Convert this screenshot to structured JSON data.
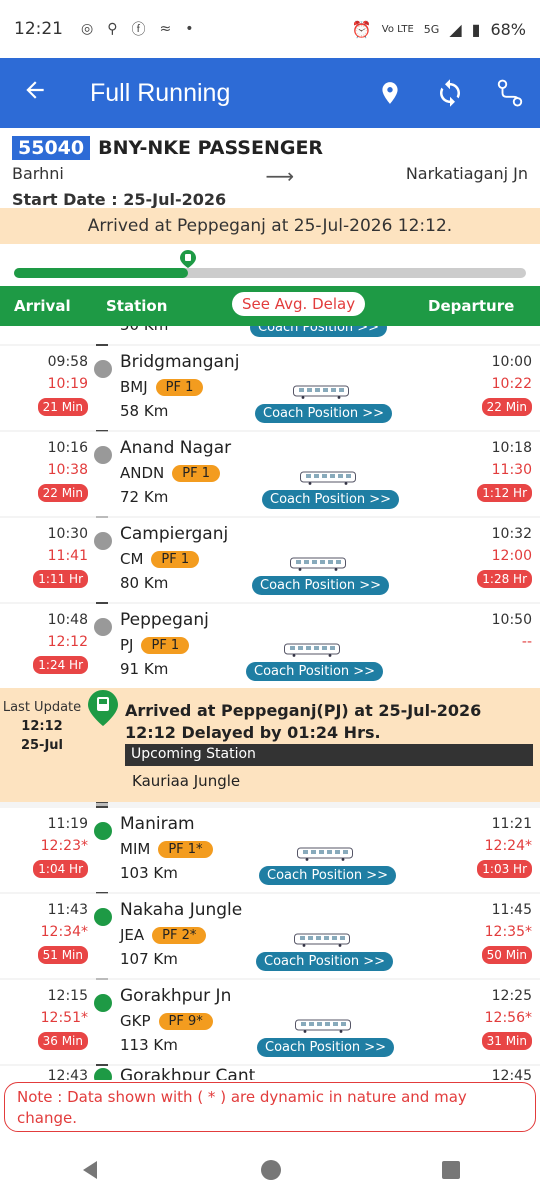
{
  "status_bar": {
    "time": "12:21",
    "battery": "68%",
    "network": "5G"
  },
  "app_bar": {
    "title": "Full Running",
    "back_icon": "arrow-left-icon",
    "icons": [
      "location-pin-icon",
      "refresh-icon",
      "route-icon"
    ]
  },
  "train": {
    "number": "55040",
    "name": "BNY-NKE PASSENGER",
    "from": "Barhni",
    "to": "Narkatiaganj Jn",
    "start_date_label": "Start Date : ",
    "start_date": "25-Jul-2026"
  },
  "arrived_banner": "Arrived at Peppeganj at 25-Jul-2026 12:12.",
  "progress": {
    "fraction": 0.34
  },
  "table_header": {
    "arrival": "Arrival",
    "station": "Station",
    "avg_delay": "See Avg. Delay",
    "departure": "Departure"
  },
  "partial_top": {
    "km": "50 Km",
    "coach": "Coach Position >>"
  },
  "stations_before": [
    {
      "sch_arr": "09:58",
      "act_arr": "10:19",
      "delay_arr": "21 Min",
      "name": "Bridgmanganj",
      "code": "BMJ",
      "pf": "PF 1",
      "km": "58 Km",
      "sch_dep": "10:00",
      "act_dep": "10:22",
      "delay_dep": "22 Min",
      "coach": "Coach Position >>"
    },
    {
      "sch_arr": "10:16",
      "act_arr": "10:38",
      "delay_arr": "22 Min",
      "name": "Anand Nagar",
      "code": "ANDN",
      "pf": "PF 1",
      "km": "72 Km",
      "sch_dep": "10:18",
      "act_dep": "11:30",
      "delay_dep": "1:12 Hr",
      "coach": "Coach Position >>"
    },
    {
      "sch_arr": "10:30",
      "act_arr": "11:41",
      "delay_arr": "1:11 Hr",
      "name": "Campierganj",
      "code": "CM",
      "pf": "PF 1",
      "km": "80 Km",
      "sch_dep": "10:32",
      "act_dep": "12:00",
      "delay_dep": "1:28 Hr",
      "coach": "Coach Position >>"
    },
    {
      "sch_arr": "10:48",
      "act_arr": "12:12",
      "delay_arr": "1:24 Hr",
      "name": "Peppeganj",
      "code": "PJ",
      "pf": "PF 1",
      "km": "91 Km",
      "sch_dep": "10:50",
      "act_dep": "--",
      "delay_dep": "",
      "coach": "Coach Position >>"
    }
  ],
  "current": {
    "last_update": "Last Update",
    "time": "12:12",
    "date": "25-Jul",
    "message": "Arrived at Peppeganj(PJ) at 25-Jul-2026 12:12 Delayed by 01:24 Hrs.",
    "upcoming_label": "Upcoming Station",
    "upcoming_station": "Kauriaa Jungle"
  },
  "stations_after": [
    {
      "sch_arr": "11:19",
      "act_arr": "12:23*",
      "delay_arr": "1:04 Hr",
      "name": "Maniram",
      "code": "MIM",
      "pf": "PF 1*",
      "km": "103 Km",
      "sch_dep": "11:21",
      "act_dep": "12:24*",
      "delay_dep": "1:03 Hr",
      "coach": "Coach Position >>"
    },
    {
      "sch_arr": "11:43",
      "act_arr": "12:34*",
      "delay_arr": "51 Min",
      "name": "Nakaha Jungle",
      "code": "JEA",
      "pf": "PF 2*",
      "km": "107 Km",
      "sch_dep": "11:45",
      "act_dep": "12:35*",
      "delay_dep": "50 Min",
      "coach": "Coach Position >>"
    },
    {
      "sch_arr": "12:15",
      "act_arr": "12:51*",
      "delay_arr": "36 Min",
      "name": "Gorakhpur Jn",
      "code": "GKP",
      "pf": "PF 9*",
      "km": "113 Km",
      "sch_dep": "12:25",
      "act_dep": "12:56*",
      "delay_dep": "31 Min",
      "coach": "Coach Position >>"
    }
  ],
  "partial_bottom": {
    "sch_arr": "12:43",
    "name": "Gorakhpur Cant",
    "sch_dep": "12:45"
  },
  "note": "Note : Data shown with ( * ) are dynamic in nature and may change.",
  "colors": {
    "primary": "#2d6bd6",
    "green": "#1e9a45",
    "delay_red": "#e84545",
    "pf_orange": "#f39c1f",
    "banner": "#fde3c0",
    "coach_btn": "#1f7ea3"
  }
}
